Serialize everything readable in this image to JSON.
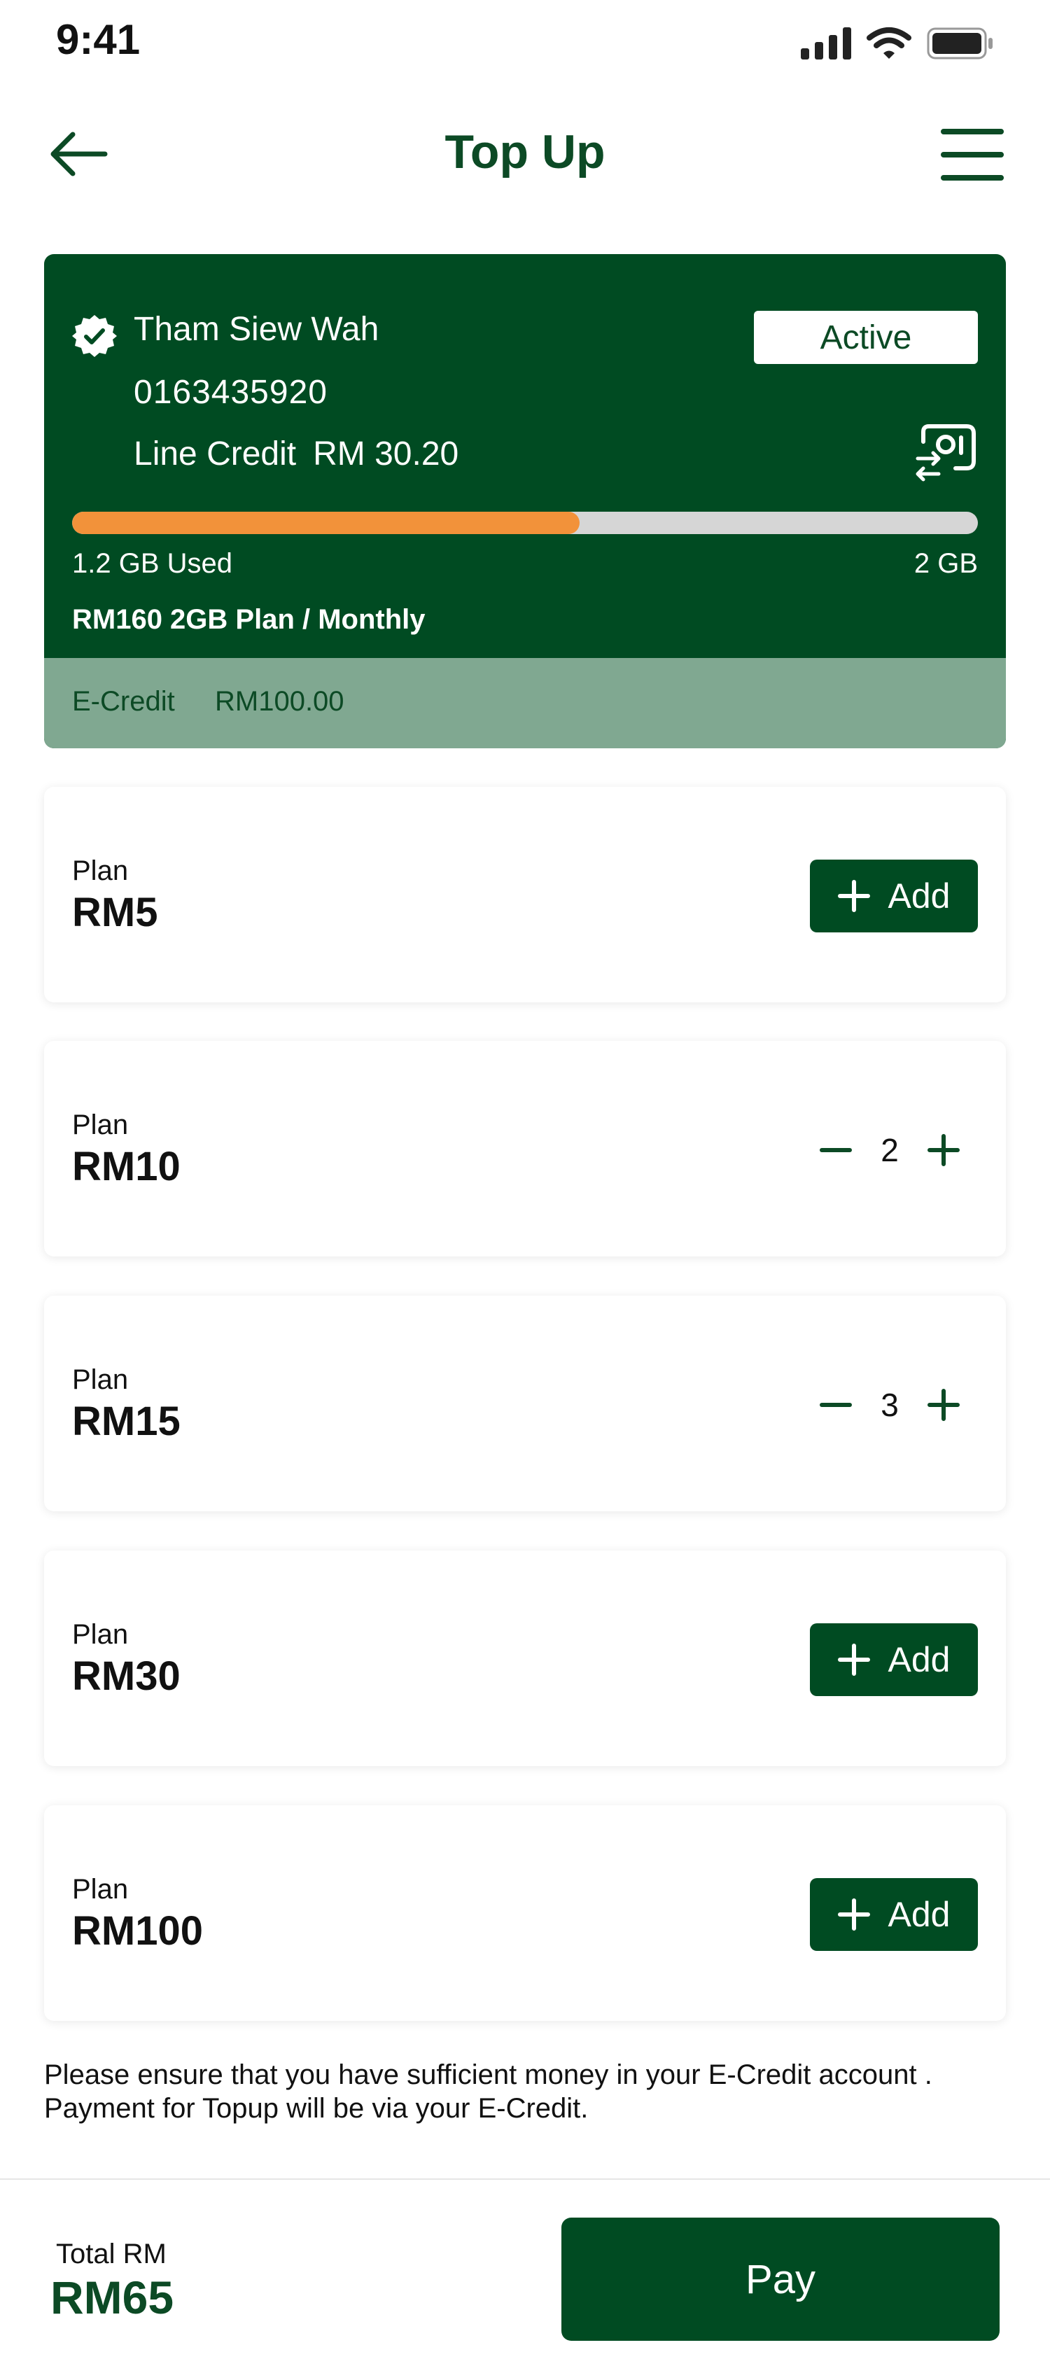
{
  "status_bar": {
    "time": "9:41"
  },
  "header": {
    "title": "Top Up"
  },
  "account": {
    "name": "Tham Siew Wah",
    "phone": "0163435920",
    "line_credit_label": "Line Credit",
    "line_credit_value": "RM 30.20",
    "status": "Active",
    "usage_fraction": 0.56,
    "used_text": "1.2 GB Used",
    "capacity_text": "2 GB",
    "plan_name": "RM160 2GB Plan / Monthly",
    "ecredit_label": "E-Credit",
    "ecredit_value": "RM100.00"
  },
  "plans": [
    {
      "label": "Plan",
      "price": "RM5",
      "mode": "add",
      "add_label": "Add"
    },
    {
      "label": "Plan",
      "price": "RM10",
      "mode": "stepper",
      "count": "2"
    },
    {
      "label": "Plan",
      "price": "RM15",
      "mode": "stepper",
      "count": "3"
    },
    {
      "label": "Plan",
      "price": "RM30",
      "mode": "add",
      "add_label": "Add"
    },
    {
      "label": "Plan",
      "price": "RM100",
      "mode": "add",
      "add_label": "Add"
    }
  ],
  "note": "Please ensure that you have sufficient money in your E-Credit account . Payment for Topup will be via your E-Credit.",
  "footer": {
    "total_label": "Total RM",
    "total_value": "RM65",
    "pay_label": "Pay"
  },
  "colors": {
    "brand": "#004b22",
    "progress": "#f2923a",
    "ecredit_bar": "#80a891"
  }
}
